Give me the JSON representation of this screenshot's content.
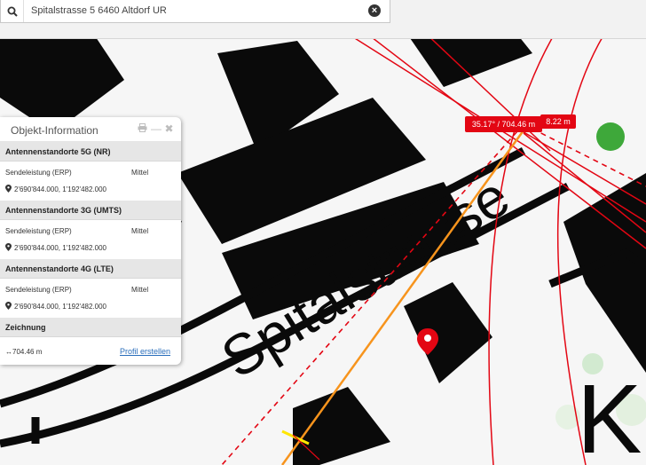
{
  "search": {
    "value": "Spitalstrasse 5 6460 Altdorf UR"
  },
  "map": {
    "street_label": "Spitalstrasse",
    "corner_letter": "K"
  },
  "measure": {
    "angle_distance_label": "35.17° / 704.46 m",
    "height_label": "8.22 m",
    "line_color": "#e30613",
    "profile_line_color": "#f7941d"
  },
  "panel": {
    "title": "Objekt-Information",
    "sections": [
      {
        "heading": "Antennenstandorte 5G (NR)",
        "label": "Sendeleistung (ERP)",
        "value": "Mittel",
        "coords": "2'690'844.000, 1'192'482.000"
      },
      {
        "heading": "Antennenstandorte 3G (UMTS)",
        "label": "Sendeleistung (ERP)",
        "value": "Mittel",
        "coords": "2'690'844.000, 1'192'482.000"
      },
      {
        "heading": "Antennenstandorte 4G (LTE)",
        "label": "Sendeleistung (ERP)",
        "value": "Mittel",
        "coords": "2'690'844.000, 1'192'482.000"
      }
    ],
    "drawing": {
      "heading": "Zeichnung",
      "length": "↔704.46 m",
      "profile_link": "Profil erstellen"
    }
  },
  "icons": {
    "search": "search-icon",
    "clear": "clear-search-icon",
    "print": "print-icon",
    "minimize": "minimize-icon",
    "close": "close-icon",
    "pin": "map-pin-icon"
  }
}
